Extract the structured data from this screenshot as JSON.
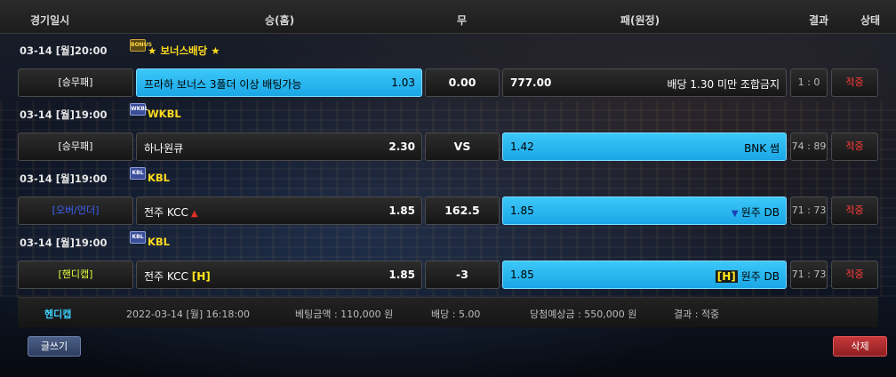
{
  "header": {
    "date_col": "경기일시",
    "home_col": "승(홈)",
    "draw_col": "무",
    "away_col": "패(원정)",
    "result_col": "결과",
    "status_col": "상태"
  },
  "games": [
    {
      "date": "03-14 [월]20:00",
      "league_icon": "BONUS",
      "league": "★ 보너스배당 ★",
      "type": "[승무패]",
      "home": "프라하 보너스 3폴더 이상 배팅가능",
      "home_odds": "1.03",
      "draw": "0.00",
      "away_odds": "777.00",
      "away": "배당 1.30 미만 조합금지",
      "result": "1 : 0",
      "status": "적중"
    },
    {
      "date": "03-14 [월]19:00",
      "league_icon": "WKBL",
      "league": "WKBL",
      "type": "[승무패]",
      "home": "하나원큐",
      "home_odds": "2.30",
      "draw": "VS",
      "away_odds": "1.42",
      "away": "BNK 썸",
      "result": "74 : 89",
      "status": "적중"
    },
    {
      "date": "03-14 [월]19:00",
      "league_icon": "KBL",
      "league": "KBL",
      "type": "[오버/언더]",
      "home": "전주 KCC",
      "home_odds": "1.85",
      "draw": "162.5",
      "away_odds": "1.85",
      "away": "원주 DB",
      "result": "71 : 73",
      "status": "적중",
      "home_arrow": "▲",
      "away_arrow": "▼"
    },
    {
      "date": "03-14 [월]19:00",
      "league_icon": "KBL",
      "league": "KBL",
      "type": "[핸디캡]",
      "home": "전주 KCC",
      "home_marker": "[H]",
      "home_odds": "1.85",
      "draw": "-3",
      "away_odds": "1.85",
      "away_marker": "[H]",
      "away": "원주 DB",
      "result": "71 : 73",
      "status": "적중"
    }
  ],
  "summary": {
    "kind": "헨디캡",
    "datetime": "2022-03-14 [월] 16:18:00",
    "bet_amount": "베팅금액 : 110,000 원",
    "odds": "배당 : 5.00",
    "expected": "당첨예상금 : 550,000 원",
    "result": "결과 : 적중"
  },
  "buttons": {
    "write": "글쓰기",
    "delete": "삭제"
  },
  "colors": {
    "active_cell": "#2bb8f0",
    "league_name": "#ffdc1e",
    "status_hit": "#ff3b3b",
    "summary_kind": "#3dd0ff"
  }
}
